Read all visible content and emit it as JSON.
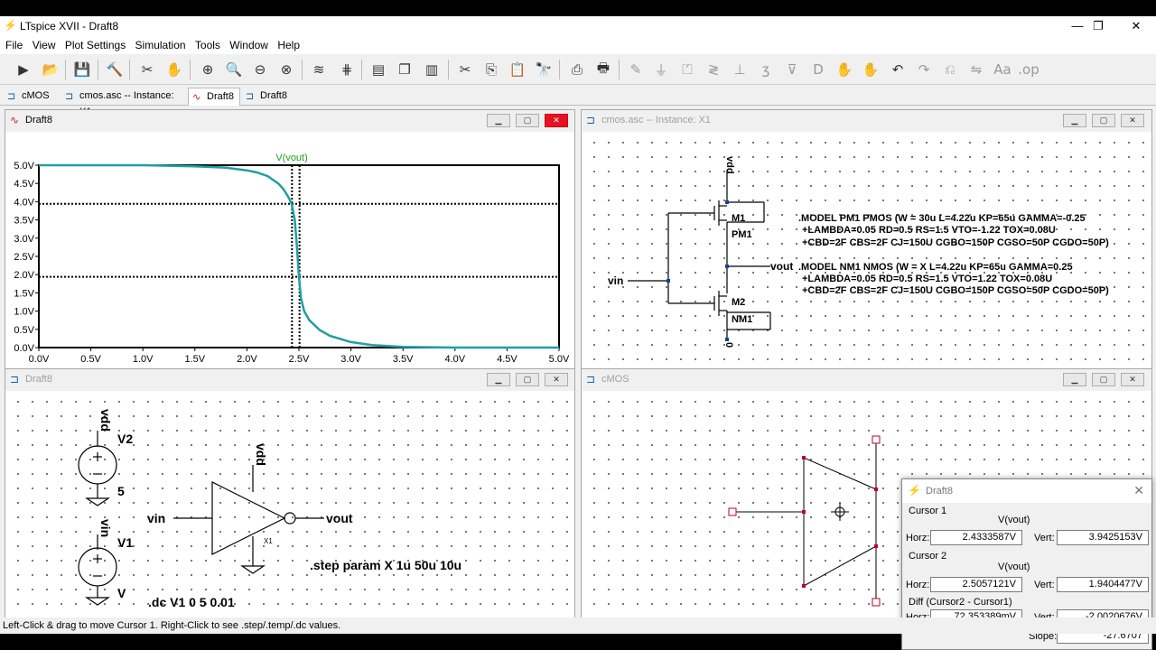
{
  "app": {
    "title": "LTspice XVII - Draft8",
    "controls": {
      "minimize": "—",
      "restore": "❐",
      "close": "✕"
    }
  },
  "menu": [
    "File",
    "View",
    "Plot Settings",
    "Simulation",
    "Tools",
    "Window",
    "Help"
  ],
  "tabs": [
    {
      "label": "cMOS",
      "icon": "schematic-icon"
    },
    {
      "label": "cmos.asc -- Instance: X1",
      "icon": "schematic-icon"
    },
    {
      "label": "Draft8",
      "icon": "waveform-icon"
    },
    {
      "label": "Draft8",
      "icon": "schematic-icon"
    }
  ],
  "windows": {
    "plot": {
      "title": "Draft8"
    },
    "instance": {
      "title": "cmos.asc -- Instance: X1"
    },
    "draft": {
      "title": "Draft8"
    },
    "cmos": {
      "title": "cMOS"
    }
  },
  "waveform": {
    "trace_label": "V(vout)"
  },
  "chart_data": {
    "type": "line",
    "title": "",
    "xlabel": "",
    "ylabel": "",
    "xlim": [
      0,
      5
    ],
    "ylim": [
      0,
      5
    ],
    "x_ticks": [
      "0.0V",
      "0.5V",
      "1.0V",
      "1.5V",
      "2.0V",
      "2.5V",
      "3.0V",
      "3.5V",
      "4.0V",
      "4.5V",
      "5.0V"
    ],
    "y_ticks": [
      "0.0V",
      "0.5V",
      "1.0V",
      "1.5V",
      "2.0V",
      "2.5V",
      "3.0V",
      "3.5V",
      "4.0V",
      "4.5V",
      "5.0V"
    ],
    "grid": false,
    "series": [
      {
        "name": "V(vout)",
        "color": "#20a0a0",
        "x": [
          0,
          1.0,
          1.5,
          1.8,
          2.0,
          2.1,
          2.2,
          2.3,
          2.35,
          2.4,
          2.43,
          2.46,
          2.48,
          2.5,
          2.52,
          2.55,
          2.6,
          2.7,
          2.8,
          3.0,
          3.2,
          3.5,
          4.0,
          5.0
        ],
        "y": [
          5.0,
          5.0,
          4.97,
          4.93,
          4.86,
          4.8,
          4.7,
          4.5,
          4.35,
          4.12,
          3.94,
          3.5,
          2.8,
          1.94,
          1.35,
          1.0,
          0.75,
          0.48,
          0.32,
          0.15,
          0.07,
          0.02,
          0.0,
          0.0
        ]
      }
    ],
    "cursors": [
      {
        "x": 2.4333587,
        "y": 3.9425153
      },
      {
        "x": 2.5057121,
        "y": 1.9404477
      }
    ]
  },
  "instance_schematic": {
    "net_vdd": "vdd",
    "net_vin": "vin",
    "net_vout": "vout",
    "net_gnd": "0",
    "m1": "M1",
    "pm1": "PM1",
    "m2": "M2",
    "nm1": "NM1",
    "model_pm1": [
      ".MODEL PM1 PMOS (W = 30u L=4.22u KP=65u GAMMA=-0.25",
      "+LAMBDA=0.05 RD=0.5 RS=1.5 VTO=-1.22 TOX=0.08U",
      "+CBD=2F CBS=2F CJ=150U CGBO=150P CGSO=50P CGDO=50P)"
    ],
    "model_nm1": [
      ".MODEL NM1 NMOS (W = X L=4.22u KP=65u GAMMA=0.25",
      "+LAMBDA=0.05 RD=0.5 RS=1.5 VTO=1.22 TOX=0.08U",
      "+CBD=2F CBS=2F CJ=150U CGBO=150P CGSO=50P CGDO=50P)"
    ]
  },
  "draft_schematic": {
    "v2_net": "vdd",
    "v2_name": "V2",
    "v2_value": "5",
    "v1_net": "vin",
    "v1_name": "V1",
    "v1_value": "V",
    "inv_vdd": "vdd",
    "inv_in": "vin",
    "inv_out": "vout",
    "inv_inst": "X1",
    "step": ".step param X 1u 50u 10u",
    "dc": ".dc V1 0 5 0.01"
  },
  "cursor_dialog": {
    "title": "Draft8",
    "cursor1": {
      "label": "Cursor 1",
      "trace": "V(vout)",
      "horz_label": "Horz:",
      "horz": "2.4333587V",
      "vert_label": "Vert:",
      "vert": "3.9425153V"
    },
    "cursor2": {
      "label": "Cursor 2",
      "trace": "V(vout)",
      "horz_label": "Horz:",
      "horz": "2.5057121V",
      "vert_label": "Vert:",
      "vert": "1.9404477V"
    },
    "diff": {
      "label": "Diff (Cursor2 - Cursor1)",
      "horz_label": "Horz:",
      "horz": "72.353389mV",
      "vert_label": "Vert:",
      "vert": "-2.0020676V",
      "slope_label": "Slope:",
      "slope": "-27.6707"
    }
  },
  "status": "Left-Click & drag to move Cursor 1.  Right-Click to see .step/.temp/.dc values."
}
